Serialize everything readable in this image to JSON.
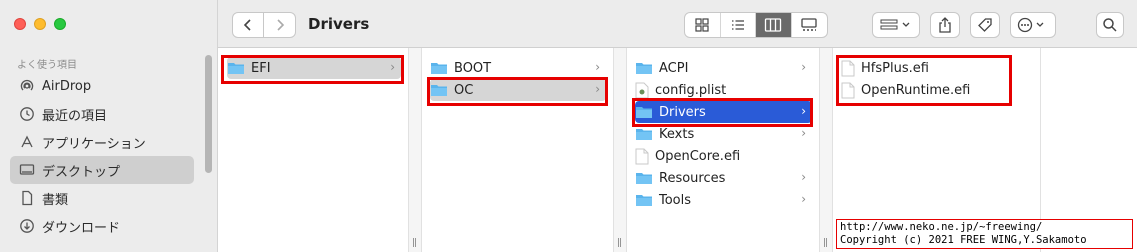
{
  "window": {
    "title": "Drivers"
  },
  "sidebar": {
    "section": "よく使う項目",
    "items": [
      {
        "label": "AirDrop",
        "icon": "airdrop-icon"
      },
      {
        "label": "最近の項目",
        "icon": "clock-icon"
      },
      {
        "label": "アプリケーション",
        "icon": "apps-icon"
      },
      {
        "label": "デスクトップ",
        "icon": "desktop-icon",
        "selected": true
      },
      {
        "label": "書類",
        "icon": "document-icon"
      },
      {
        "label": "ダウンロード",
        "icon": "download-icon"
      }
    ]
  },
  "columns": [
    {
      "items": [
        {
          "name": "EFI",
          "type": "folder",
          "chevron": "›",
          "selected": "gray"
        }
      ]
    },
    {
      "items": [
        {
          "name": "BOOT",
          "type": "folder",
          "chevron": "›"
        },
        {
          "name": "OC",
          "type": "folder",
          "chevron": "›",
          "selected": "gray"
        }
      ]
    },
    {
      "items": [
        {
          "name": "ACPI",
          "type": "folder",
          "chevron": "›"
        },
        {
          "name": "config.plist",
          "type": "plist"
        },
        {
          "name": "Drivers",
          "type": "folder",
          "chevron": "›",
          "selected": "blue"
        },
        {
          "name": "Kexts",
          "type": "folder",
          "chevron": "›"
        },
        {
          "name": "OpenCore.efi",
          "type": "file"
        },
        {
          "name": "Resources",
          "type": "folder",
          "chevron": "›"
        },
        {
          "name": "Tools",
          "type": "folder",
          "chevron": "›"
        }
      ]
    },
    {
      "items": [
        {
          "name": "HfsPlus.efi",
          "type": "file"
        },
        {
          "name": "OpenRuntime.efi",
          "type": "file"
        }
      ]
    }
  ],
  "copyright": {
    "line1": "http://www.neko.ne.jp/~freewing/",
    "line2": "Copyright (c) 2021 FREE WING,Y.Sakamoto"
  },
  "colors": {
    "highlight": "#e60000",
    "selection_blue": "#2a5bd7",
    "folder": "#5ab4ec"
  }
}
